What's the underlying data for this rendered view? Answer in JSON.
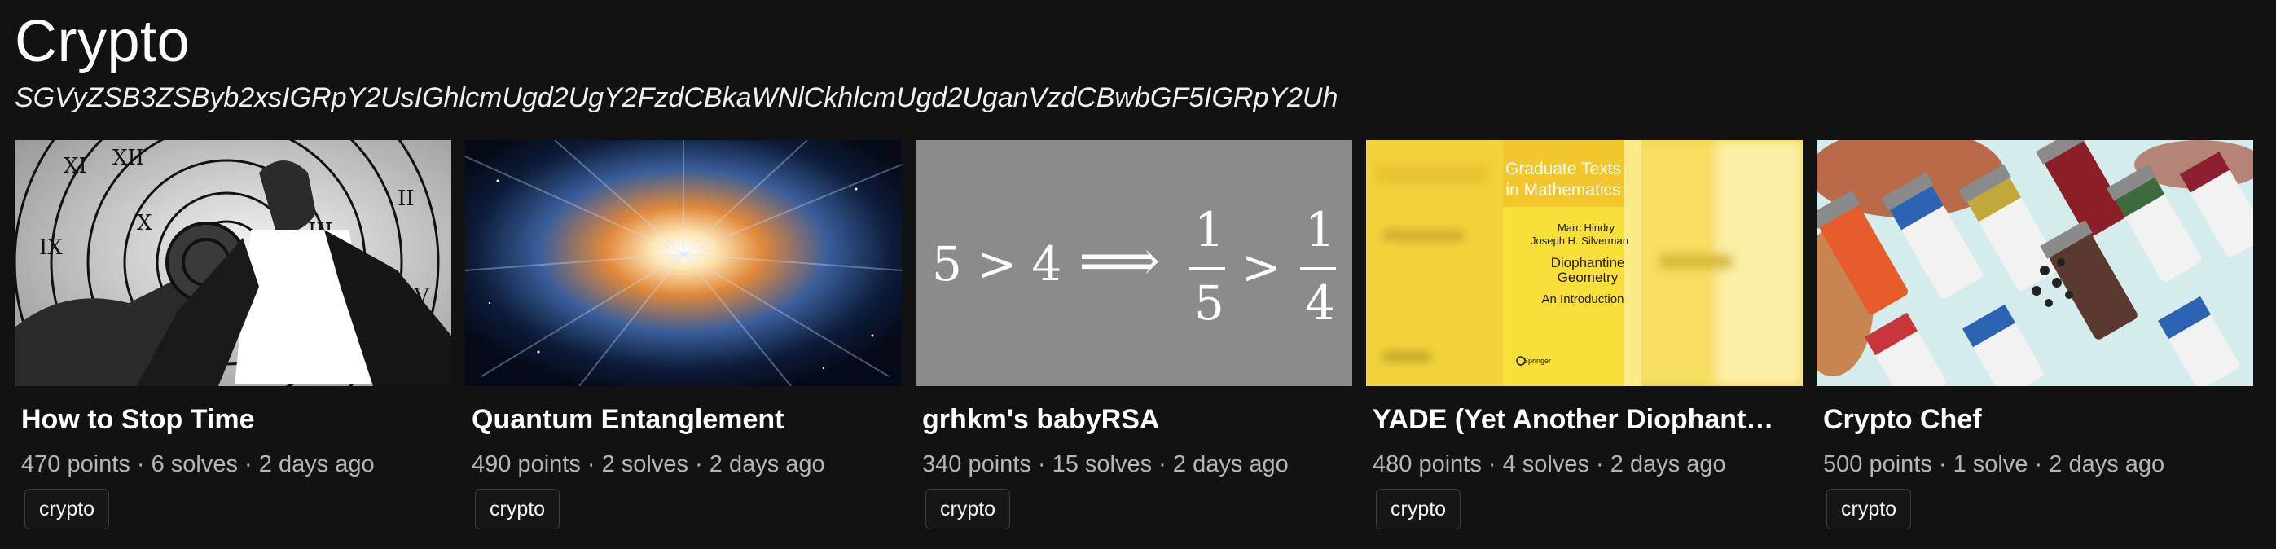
{
  "page": {
    "title": "Crypto",
    "subtitle": "SGVyZSB3ZSByb2xsIGRpY2UsIGhlcmUgd2UgY2FzdCBkaWNlCkhlcmUgd2UganVzdCBwbGF5IGRpY2Uh"
  },
  "cards": [
    {
      "title": "How to Stop Time",
      "points": "470 points",
      "solves": "6 solves",
      "age": "2 days ago",
      "tag": "crypto",
      "image_icon": "clock-portrait-image"
    },
    {
      "title": "Quantum Entanglement",
      "points": "490 points",
      "solves": "2 solves",
      "age": "2 days ago",
      "tag": "crypto",
      "image_icon": "cosmic-burst-image"
    },
    {
      "title": "grhkm's babyRSA",
      "points": "340 points",
      "solves": "15 solves",
      "age": "2 days ago",
      "tag": "crypto",
      "image_icon": "inequality-math-image",
      "image_text": {
        "left": "5 > 4",
        "arrow": "⟹",
        "frac1_num": "1",
        "frac1_den": "5",
        "gt": ">",
        "frac2_num": "1",
        "frac2_den": "4"
      }
    },
    {
      "title": "YADE (Yet Another Diophant…",
      "points": "480 points",
      "solves": "4 solves",
      "age": "2 days ago",
      "tag": "crypto",
      "image_icon": "book-cover-image",
      "image_text": {
        "series_line1": "Graduate Texts",
        "series_line2": "in Mathematics",
        "authors1": "Marc Hindry",
        "authors2": "Joseph H. Silverman",
        "book_title1": "Diophantine",
        "book_title2": "Geometry",
        "book_sub": "An Introduction",
        "publisher": "Springer"
      }
    },
    {
      "title": "Crypto Chef",
      "points": "500 points",
      "solves": "1 solve",
      "age": "2 days ago",
      "tag": "crypto",
      "image_icon": "spice-jars-image"
    }
  ],
  "meta_separator": " · "
}
